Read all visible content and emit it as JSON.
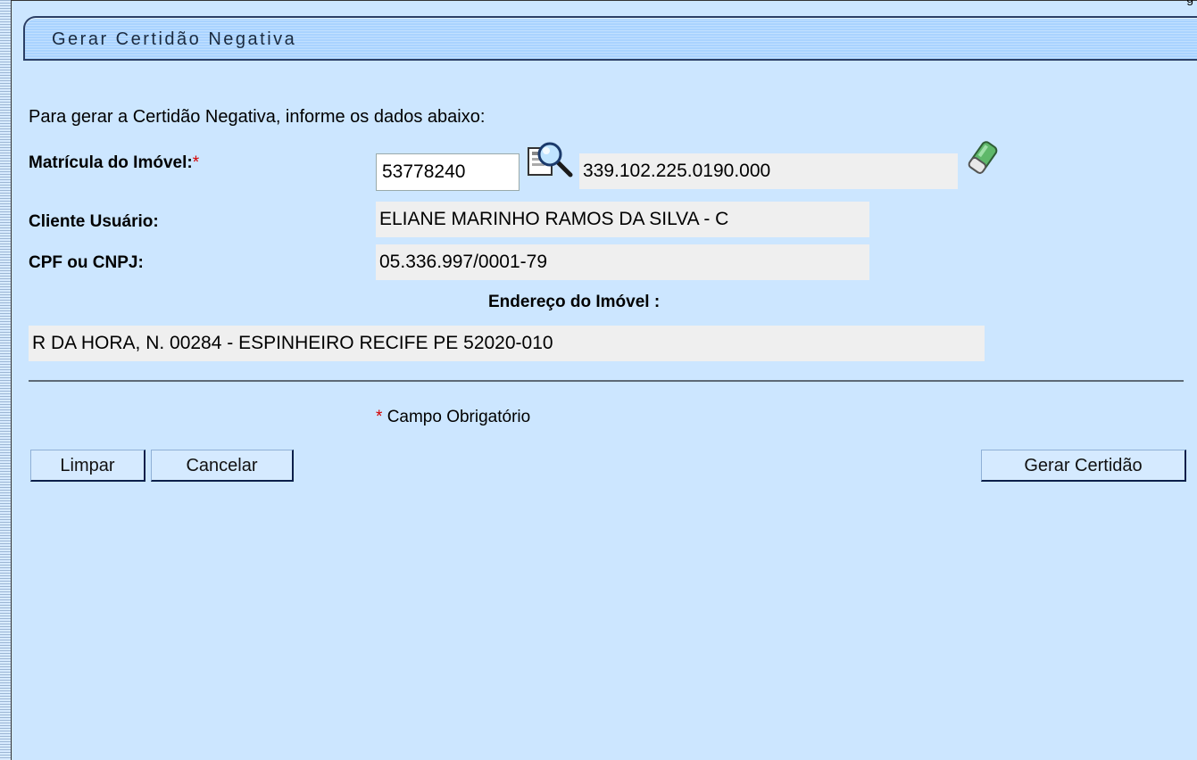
{
  "page": {
    "title": "Gerar Certidão Negativa",
    "intro": "Para gerar a Certidão Negativa, informe os dados abaixo:",
    "top_right_fragment": "g"
  },
  "form": {
    "matricula_label": "Matrícula do Imóvel:",
    "required_mark": "*",
    "matricula_value": "53778240",
    "inscricao_value": "339.102.225.0190.000",
    "cliente_label": "Cliente Usuário:",
    "cliente_value": "ELIANE MARINHO RAMOS DA SILVA - C",
    "cpf_label": "CPF ou CNPJ:",
    "cpf_value": "05.336.997/0001-79",
    "endereco_label": "Endereço do Imóvel :",
    "endereco_value": "R DA HORA, N. 00284 - ESPINHEIRO RECIFE PE 52020-010",
    "mandatory_text": "Campo Obrigatório"
  },
  "buttons": {
    "limpar": "Limpar",
    "cancelar": "Cancelar",
    "gerar": "Gerar Certidão"
  },
  "icons": {
    "search": "magnifier-search-icon",
    "clear": "eraser-icon"
  },
  "colors": {
    "background": "#cce6ff",
    "field_bg": "#efefef",
    "required": "#d40000"
  }
}
